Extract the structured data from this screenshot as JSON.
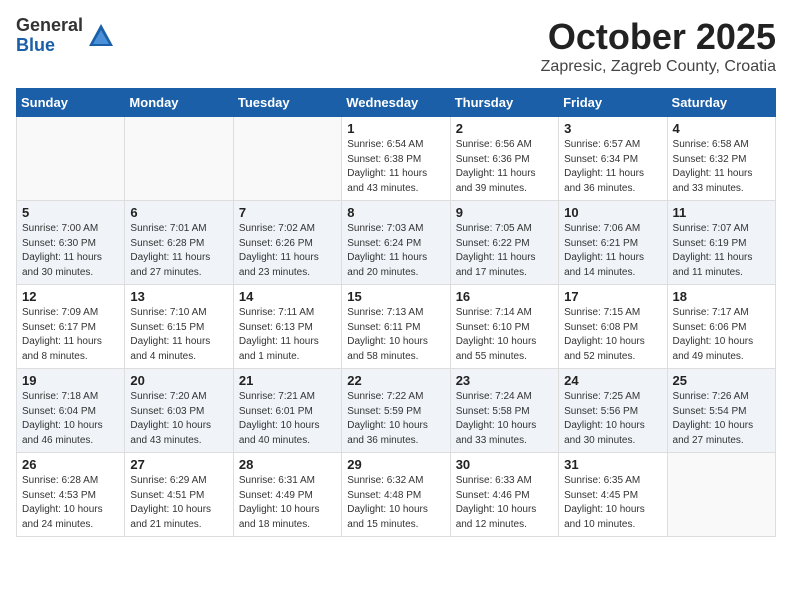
{
  "logo": {
    "general": "General",
    "blue": "Blue"
  },
  "title": {
    "month": "October 2025",
    "location": "Zapresic, Zagreb County, Croatia"
  },
  "weekdays": [
    "Sunday",
    "Monday",
    "Tuesday",
    "Wednesday",
    "Thursday",
    "Friday",
    "Saturday"
  ],
  "weeks": [
    [
      {
        "day": "",
        "info": ""
      },
      {
        "day": "",
        "info": ""
      },
      {
        "day": "",
        "info": ""
      },
      {
        "day": "1",
        "info": "Sunrise: 6:54 AM\nSunset: 6:38 PM\nDaylight: 11 hours\nand 43 minutes."
      },
      {
        "day": "2",
        "info": "Sunrise: 6:56 AM\nSunset: 6:36 PM\nDaylight: 11 hours\nand 39 minutes."
      },
      {
        "day": "3",
        "info": "Sunrise: 6:57 AM\nSunset: 6:34 PM\nDaylight: 11 hours\nand 36 minutes."
      },
      {
        "day": "4",
        "info": "Sunrise: 6:58 AM\nSunset: 6:32 PM\nDaylight: 11 hours\nand 33 minutes."
      }
    ],
    [
      {
        "day": "5",
        "info": "Sunrise: 7:00 AM\nSunset: 6:30 PM\nDaylight: 11 hours\nand 30 minutes."
      },
      {
        "day": "6",
        "info": "Sunrise: 7:01 AM\nSunset: 6:28 PM\nDaylight: 11 hours\nand 27 minutes."
      },
      {
        "day": "7",
        "info": "Sunrise: 7:02 AM\nSunset: 6:26 PM\nDaylight: 11 hours\nand 23 minutes."
      },
      {
        "day": "8",
        "info": "Sunrise: 7:03 AM\nSunset: 6:24 PM\nDaylight: 11 hours\nand 20 minutes."
      },
      {
        "day": "9",
        "info": "Sunrise: 7:05 AM\nSunset: 6:22 PM\nDaylight: 11 hours\nand 17 minutes."
      },
      {
        "day": "10",
        "info": "Sunrise: 7:06 AM\nSunset: 6:21 PM\nDaylight: 11 hours\nand 14 minutes."
      },
      {
        "day": "11",
        "info": "Sunrise: 7:07 AM\nSunset: 6:19 PM\nDaylight: 11 hours\nand 11 minutes."
      }
    ],
    [
      {
        "day": "12",
        "info": "Sunrise: 7:09 AM\nSunset: 6:17 PM\nDaylight: 11 hours\nand 8 minutes."
      },
      {
        "day": "13",
        "info": "Sunrise: 7:10 AM\nSunset: 6:15 PM\nDaylight: 11 hours\nand 4 minutes."
      },
      {
        "day": "14",
        "info": "Sunrise: 7:11 AM\nSunset: 6:13 PM\nDaylight: 11 hours\nand 1 minute."
      },
      {
        "day": "15",
        "info": "Sunrise: 7:13 AM\nSunset: 6:11 PM\nDaylight: 10 hours\nand 58 minutes."
      },
      {
        "day": "16",
        "info": "Sunrise: 7:14 AM\nSunset: 6:10 PM\nDaylight: 10 hours\nand 55 minutes."
      },
      {
        "day": "17",
        "info": "Sunrise: 7:15 AM\nSunset: 6:08 PM\nDaylight: 10 hours\nand 52 minutes."
      },
      {
        "day": "18",
        "info": "Sunrise: 7:17 AM\nSunset: 6:06 PM\nDaylight: 10 hours\nand 49 minutes."
      }
    ],
    [
      {
        "day": "19",
        "info": "Sunrise: 7:18 AM\nSunset: 6:04 PM\nDaylight: 10 hours\nand 46 minutes."
      },
      {
        "day": "20",
        "info": "Sunrise: 7:20 AM\nSunset: 6:03 PM\nDaylight: 10 hours\nand 43 minutes."
      },
      {
        "day": "21",
        "info": "Sunrise: 7:21 AM\nSunset: 6:01 PM\nDaylight: 10 hours\nand 40 minutes."
      },
      {
        "day": "22",
        "info": "Sunrise: 7:22 AM\nSunset: 5:59 PM\nDaylight: 10 hours\nand 36 minutes."
      },
      {
        "day": "23",
        "info": "Sunrise: 7:24 AM\nSunset: 5:58 PM\nDaylight: 10 hours\nand 33 minutes."
      },
      {
        "day": "24",
        "info": "Sunrise: 7:25 AM\nSunset: 5:56 PM\nDaylight: 10 hours\nand 30 minutes."
      },
      {
        "day": "25",
        "info": "Sunrise: 7:26 AM\nSunset: 5:54 PM\nDaylight: 10 hours\nand 27 minutes."
      }
    ],
    [
      {
        "day": "26",
        "info": "Sunrise: 6:28 AM\nSunset: 4:53 PM\nDaylight: 10 hours\nand 24 minutes."
      },
      {
        "day": "27",
        "info": "Sunrise: 6:29 AM\nSunset: 4:51 PM\nDaylight: 10 hours\nand 21 minutes."
      },
      {
        "day": "28",
        "info": "Sunrise: 6:31 AM\nSunset: 4:49 PM\nDaylight: 10 hours\nand 18 minutes."
      },
      {
        "day": "29",
        "info": "Sunrise: 6:32 AM\nSunset: 4:48 PM\nDaylight: 10 hours\nand 15 minutes."
      },
      {
        "day": "30",
        "info": "Sunrise: 6:33 AM\nSunset: 4:46 PM\nDaylight: 10 hours\nand 12 minutes."
      },
      {
        "day": "31",
        "info": "Sunrise: 6:35 AM\nSunset: 4:45 PM\nDaylight: 10 hours\nand 10 minutes."
      },
      {
        "day": "",
        "info": ""
      }
    ]
  ]
}
